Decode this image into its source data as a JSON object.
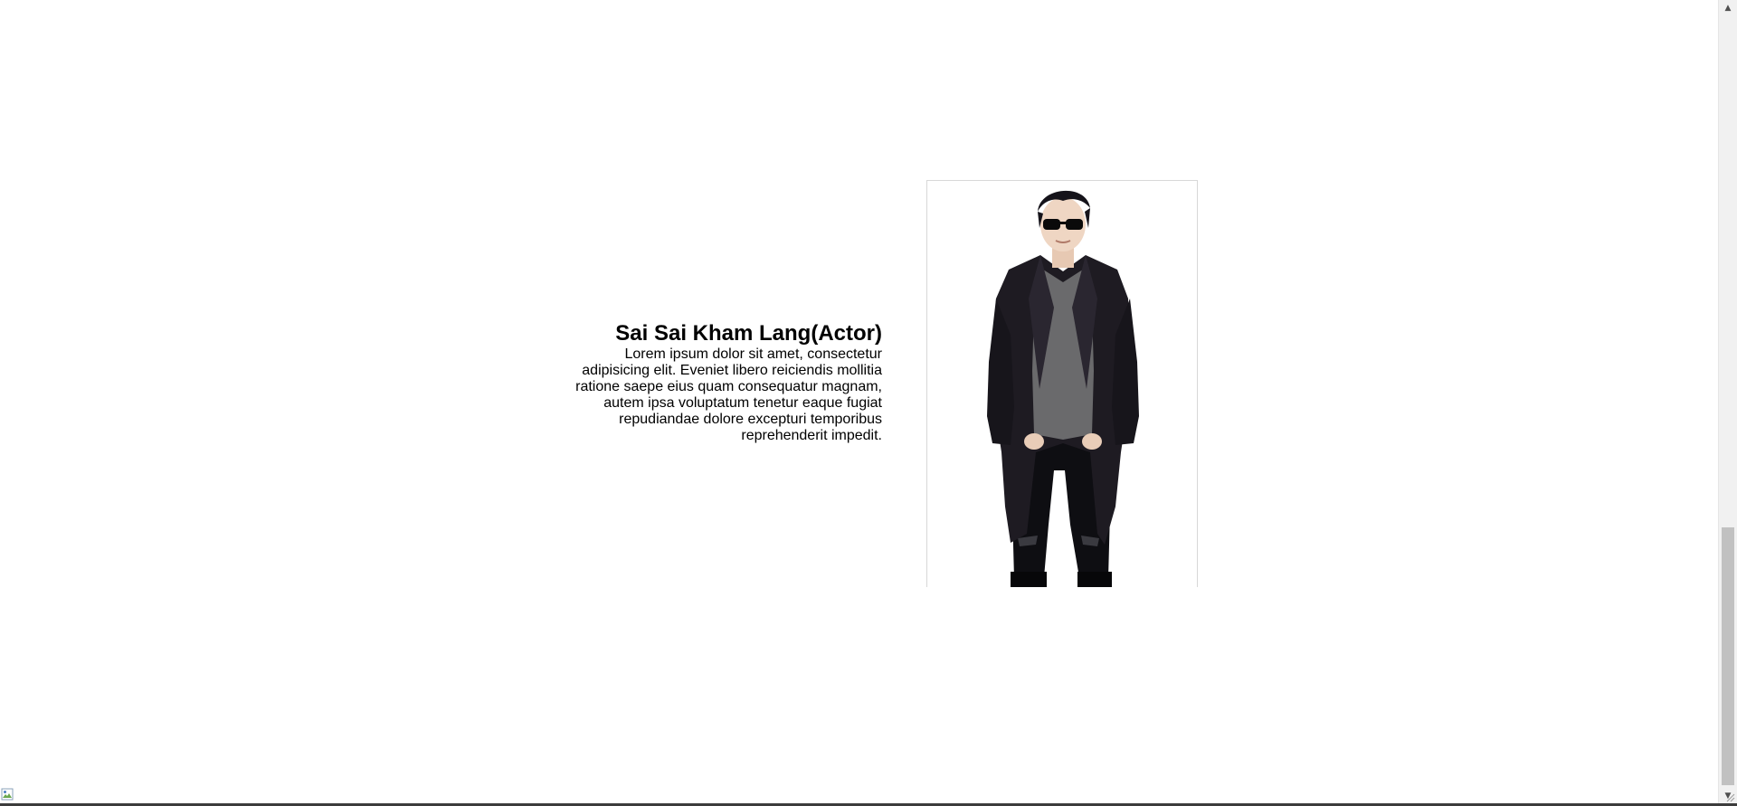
{
  "profile": {
    "name": "Sai Sai Kham Lang(Actor)",
    "description": "Lorem ipsum dolor sit amet, consectetur adipisicing elit. Eveniet libero reiciendis mollitia ratione saepe eius quam consequatur magnam, autem ipsa voluptatum tenetur eaque fugiat repudiandae dolore excepturi temporibus reprehenderit impedit.",
    "photo_icon": "person-photo"
  },
  "scrollbar": {
    "up_icon": "triangle-up-icon",
    "down_icon": "triangle-down-icon",
    "position": 0.95
  },
  "footer": {
    "broken_image_icon": "broken-image-icon"
  },
  "colors": {
    "background": "#ffffff",
    "text": "#000000",
    "coat": "#1e1b22",
    "shirt": "#6a6a6c",
    "scrollbar_thumb": "#c1c1c1"
  }
}
